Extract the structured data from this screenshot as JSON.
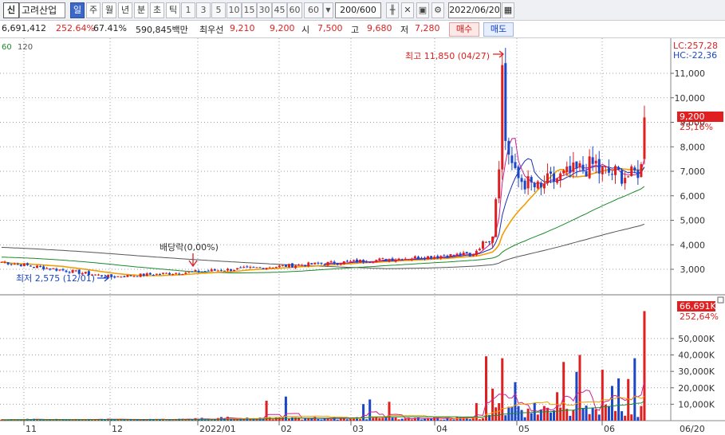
{
  "toolbar": {
    "mode_label": "신",
    "stock_name": "고려산업",
    "periods": [
      "일",
      "주",
      "월",
      "년",
      "분",
      "초",
      "틱"
    ],
    "active_period": "일",
    "intervals": [
      "1",
      "3",
      "5",
      "10",
      "15",
      "30",
      "45",
      "60"
    ],
    "interval_dropdown": "60",
    "count": "200/600",
    "date": "2022/06/20"
  },
  "info": {
    "volume": "6,691,412",
    "volume_ratio": "252.64%",
    "turnover": "67.41%",
    "amount": "590,845백만",
    "preferred_label": "최우선",
    "bid": "9,210",
    "ask": "9,200",
    "open_label": "시",
    "open": "7,500",
    "high_label": "고",
    "high": "9,680",
    "low_label": "저",
    "low": "7,280",
    "buy_label": "매수",
    "sell_label": "매도"
  },
  "price_panel": {
    "ma_legend": [
      "60",
      "120"
    ],
    "lc": "LC:257,28",
    "hc": "HC:-22,36",
    "current_price": "9,200",
    "current_change": "23,16%",
    "high_annotation": "최고 11,850 (04/27)",
    "low_annotation": "최저 2,575 (12/01)",
    "dividend_annotation": "배당락(0,00%)",
    "y_ticks": [
      "11,000",
      "10,000",
      "9,000",
      "8,000",
      "7,000",
      "6,000",
      "5,000",
      "4,000",
      "3,000"
    ]
  },
  "volume_panel": {
    "current_volume": "66,691K",
    "current_ratio": "252,64%",
    "y_ticks": [
      "50,000K",
      "40,000K",
      "30,000K",
      "20,000K",
      "10,000K"
    ]
  },
  "x_axis": [
    "11",
    "12",
    "2022/01",
    "02",
    "03",
    "04",
    "05",
    "06",
    "06/20"
  ],
  "colors": {
    "up": "#e02020",
    "down": "#1a46c8",
    "ma5": "#d02090",
    "ma10": "#1c2fb5",
    "ma20": "#f0a000",
    "ma60": "#1a8a2a",
    "ma120": "#555555"
  },
  "chart_data": {
    "type": "candlestick",
    "ylim": [
      2500,
      12000
    ],
    "events": [
      {
        "label": "최고",
        "value": 11850,
        "date": "04/27"
      },
      {
        "label": "최저",
        "value": 2575,
        "date": "12/01"
      }
    ],
    "last_candle": {
      "open": 7500,
      "high": 9680,
      "low": 7280,
      "close": 9200
    },
    "last_volume_k": 66691,
    "volume_ylim": [
      0,
      70000
    ]
  }
}
